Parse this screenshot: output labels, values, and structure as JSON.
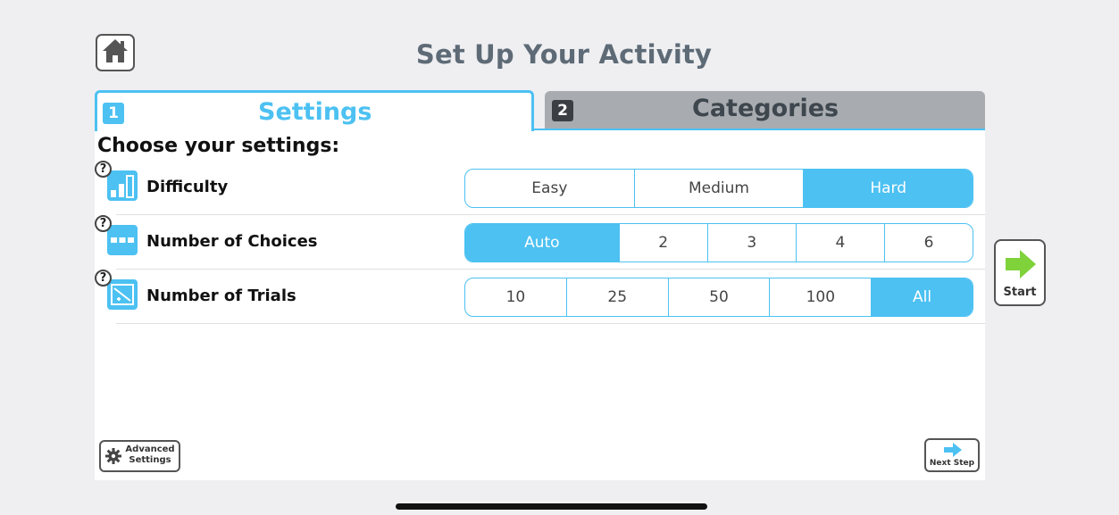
{
  "header": {
    "title": "Set Up Your Activity",
    "home_icon": "home-icon"
  },
  "tabs": [
    {
      "number": "1",
      "label": "Settings",
      "active": true
    },
    {
      "number": "2",
      "label": "Categories",
      "active": false
    }
  ],
  "settings": {
    "heading": "Choose your settings:",
    "rows": [
      {
        "label": "Difficulty",
        "icon": "difficulty-bars-icon",
        "options": [
          "Easy",
          "Medium",
          "Hard"
        ],
        "selected": "Hard"
      },
      {
        "label": "Number of Choices",
        "icon": "choices-dots-icon",
        "options": [
          "Auto",
          "2",
          "3",
          "4",
          "6"
        ],
        "selected": "Auto"
      },
      {
        "label": "Number of Trials",
        "icon": "trials-card-icon",
        "options": [
          "10",
          "25",
          "50",
          "100",
          "All"
        ],
        "selected": "All"
      }
    ],
    "help_glyph": "?"
  },
  "buttons": {
    "start": "Start",
    "advanced": "Advanced Settings",
    "advanced_line1": "Advanced",
    "advanced_line2": "Settings",
    "next_step": "Next Step"
  },
  "colors": {
    "accent": "#4cc1f2",
    "title": "#5e6b76",
    "inactive_tab": "#a8acb0",
    "start_arrow": "#7fd23a"
  }
}
